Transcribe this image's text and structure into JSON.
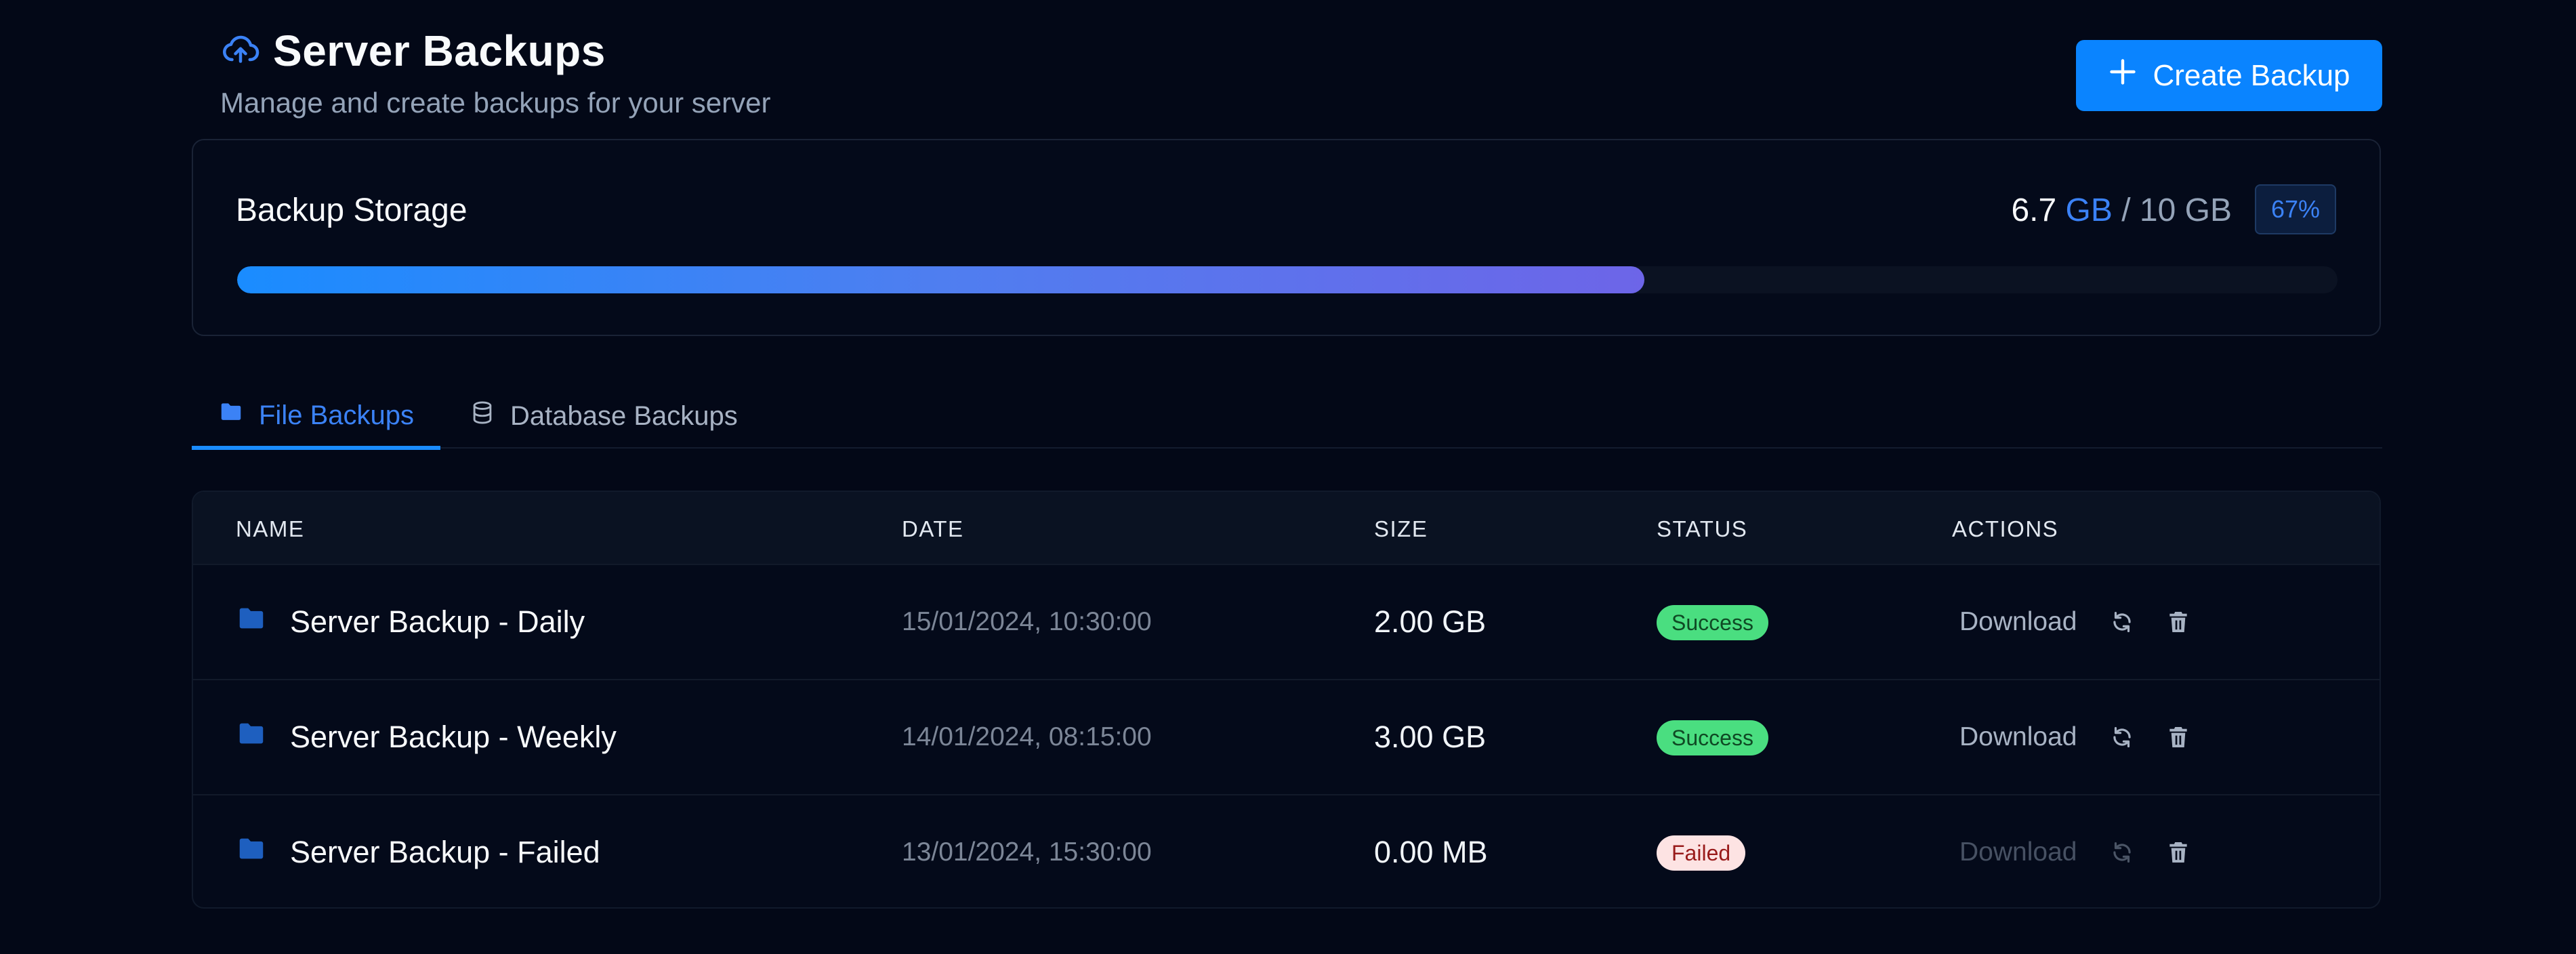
{
  "header": {
    "title": "Server Backups",
    "subtitle": "Manage and create backups for your server",
    "title_icon": "cloud-upload-icon",
    "create_button_label": "Create Backup",
    "create_button_icon": "plus-icon"
  },
  "storage": {
    "title": "Backup Storage",
    "used_value": "6.7",
    "used_unit": "GB",
    "separator": "/",
    "total": "10 GB",
    "percent_label": "67%",
    "percent_value": 67
  },
  "tabs": [
    {
      "label": "File Backups",
      "icon": "folder-icon",
      "active": true
    },
    {
      "label": "Database Backups",
      "icon": "database-icon",
      "active": false
    }
  ],
  "table": {
    "columns": [
      "NAME",
      "DATE",
      "SIZE",
      "STATUS",
      "ACTIONS"
    ],
    "rows": [
      {
        "name": "Server Backup - Daily",
        "date": "15/01/2024, 10:30:00",
        "size": "2.00 GB",
        "status": "Success",
        "download": "Download"
      },
      {
        "name": "Server Backup - Weekly",
        "date": "14/01/2024, 08:15:00",
        "size": "3.00 GB",
        "status": "Success",
        "download": "Download"
      },
      {
        "name": "Server Backup - Failed",
        "date": "13/01/2024, 15:30:00",
        "size": "0.00 MB",
        "status": "Failed",
        "download": "Download"
      }
    ]
  },
  "colors": {
    "background": "#030817",
    "accent": "#0a84ff",
    "success_badge": "#4ade80",
    "failed_badge": "#fde3e3"
  }
}
